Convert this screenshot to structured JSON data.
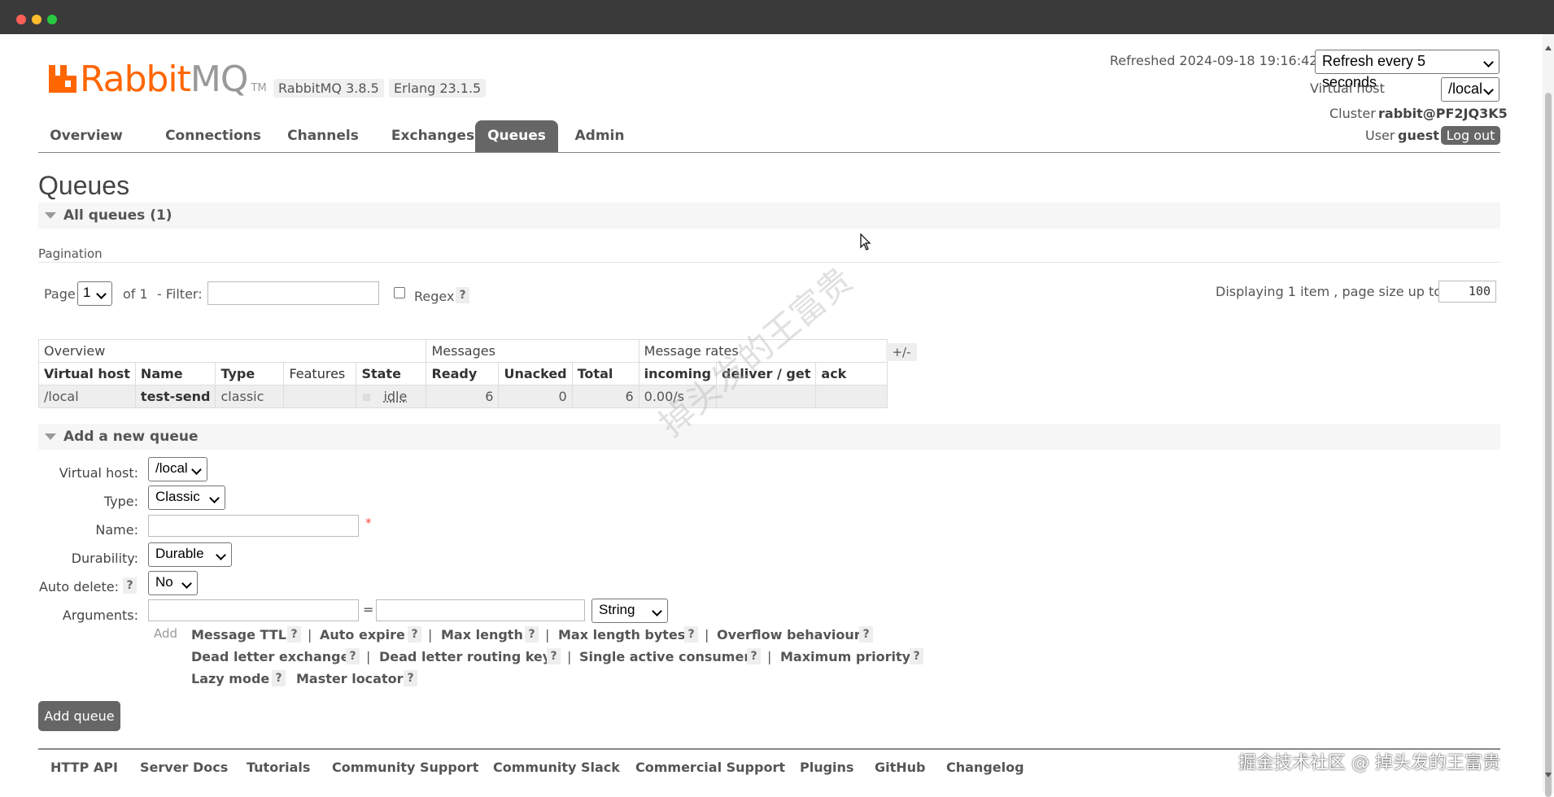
{
  "header": {
    "logo_text_orange": "Rabbit",
    "logo_text_gray": "MQ",
    "logo_tm": "TM",
    "rabbitmq_version": "RabbitMQ 3.8.5",
    "erlang_version": "Erlang 23.1.5",
    "refreshed_label": "Refreshed 2024-09-18 19:16:42",
    "refresh_select": "Refresh every 5 seconds",
    "vhost_label": "Virtual host",
    "vhost_value": "/local",
    "cluster_label": "Cluster",
    "cluster_value": "rabbit@PF2JQ3K5",
    "user_label": "User",
    "user_value": "guest",
    "logout": "Log out"
  },
  "nav": {
    "tabs": [
      "Overview",
      "Connections",
      "Channels",
      "Exchanges",
      "Queues",
      "Admin"
    ],
    "active": "Queues"
  },
  "page_title": "Queues",
  "all_queues": {
    "title": "All queues (1)",
    "pagination_label": "Pagination",
    "page_label": "Page",
    "page_value": "1",
    "of_label": "of 1",
    "filter_label": "- Filter:",
    "filter_value": "",
    "regex_label": "Regex",
    "help": "?",
    "displaying": "Displaying 1 item , page size up to:",
    "page_size": "100",
    "table": {
      "groups": [
        "Overview",
        "Messages",
        "Message rates"
      ],
      "toggle": "+/-",
      "columns": [
        "Virtual host",
        "Name",
        "Type",
        "Features",
        "State",
        "Ready",
        "Unacked",
        "Total",
        "incoming",
        "deliver / get",
        "ack"
      ],
      "rows": [
        {
          "vhost": "/local",
          "name": "test-send",
          "type": "classic",
          "features": "",
          "state": "idle",
          "ready": "6",
          "unacked": "0",
          "total": "6",
          "incoming": "0.00/s",
          "deliver": "",
          "ack": ""
        }
      ]
    }
  },
  "add_queue": {
    "title": "Add a new queue",
    "virtual_host_label": "Virtual host:",
    "virtual_host_value": "/local",
    "type_label": "Type:",
    "type_value": "Classic",
    "name_label": "Name:",
    "name_value": "",
    "required_mark": "*",
    "durability_label": "Durability:",
    "durability_value": "Durable",
    "auto_delete_label": "Auto delete:",
    "auto_delete_value": "No",
    "arguments_label": "Arguments:",
    "arg_equals": "=",
    "arg_type": "String",
    "add_label": "Add",
    "arg_links_row1": [
      "Message TTL",
      "Auto expire",
      "Max length",
      "Max length bytes",
      "Overflow behaviour"
    ],
    "arg_links_row2": [
      "Dead letter exchange",
      "Dead letter routing key",
      "Single active consumer",
      "Maximum priority"
    ],
    "arg_links_row3": [
      "Lazy mode",
      "Master locator"
    ],
    "separator": "|",
    "submit": "Add queue"
  },
  "footer": {
    "links": [
      "HTTP API",
      "Server Docs",
      "Tutorials",
      "Community Support",
      "Community Slack",
      "Commercial Support",
      "Plugins",
      "GitHub",
      "Changelog"
    ]
  },
  "watermark": {
    "corner": "掘金技术社区 @ 掉头发的王富贵",
    "diagonal": "掉头发的王富贵"
  },
  "colors": {
    "brand_orange": "#ff6600",
    "tab_active": "#666666"
  }
}
